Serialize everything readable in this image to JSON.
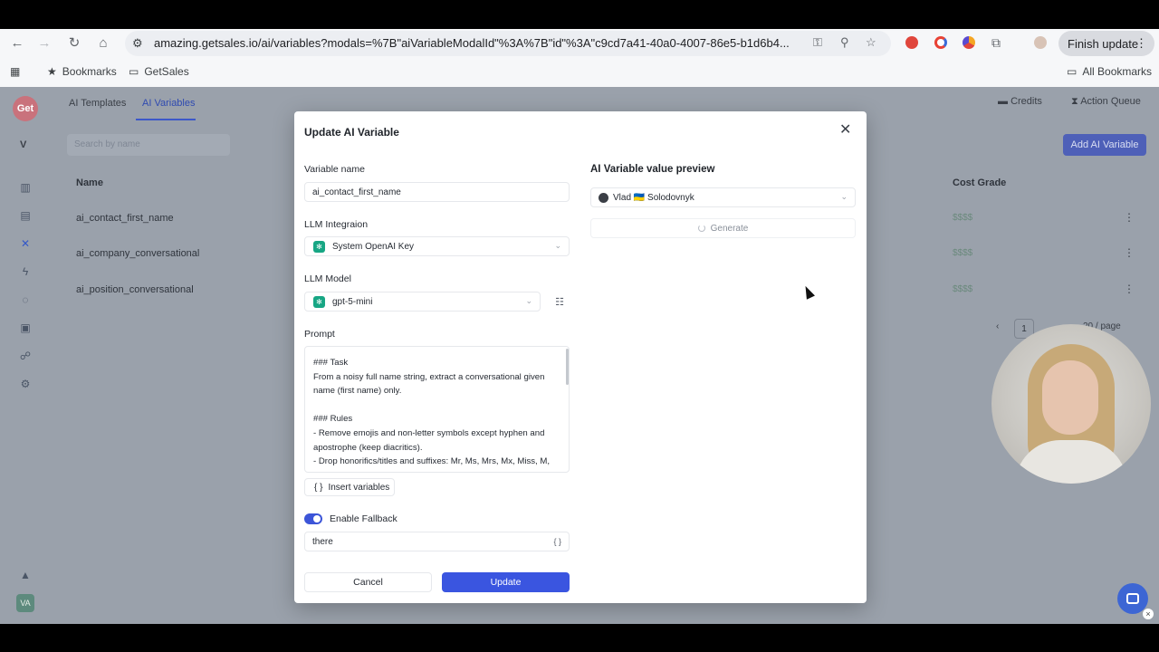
{
  "browser": {
    "url": "amazing.getsales.io/ai/variables?modals=%7B\"aiVariableModalId\"%3A%7B\"id\"%3A\"c9cd7a41-40a0-4007-86e5-b1d6b4...",
    "finish_update": "Finish update",
    "bookmarks": [
      "Bookmarks",
      "GetSales"
    ],
    "all_bookmarks": "All Bookmarks"
  },
  "app": {
    "logo": "Get",
    "workspace_initial": "V",
    "user_initials": "VA",
    "tabs": [
      "AI Templates",
      "AI Variables"
    ],
    "active_tab": "AI Variables",
    "credits": "Credits",
    "action_queue": "Action Queue",
    "search_placeholder": "Search by name",
    "add_button": "Add AI Variable",
    "columns": {
      "name": "Name",
      "cost_grade": "Cost Grade"
    },
    "rows": [
      {
        "name": "ai_contact_first_name",
        "cost": "$$$$"
      },
      {
        "name": "ai_company_conversational",
        "cost": "$$$$"
      },
      {
        "name": "ai_position_conversational",
        "cost": "$$$$"
      }
    ],
    "page_number": "1",
    "per_page": "20 / page"
  },
  "modal": {
    "title": "Update AI Variable",
    "variable_name_label": "Variable name",
    "variable_name_value": "ai_contact_first_name",
    "llm_integration_label": "LLM Integraion",
    "llm_integration_value": "System OpenAI Key",
    "llm_model_label": "LLM Model",
    "llm_model_value": "gpt-5-mini",
    "prompt_label": "Prompt",
    "prompt_text": "### Task\nFrom a noisy full name string, extract a conversational given name (first name) only.\n\n### Rules\n- Remove emojis and non-letter symbols except hyphen and apostrophe (keep diacritics).\n- Drop honorifics/titles and suffixes: Mr, Ms, Mrs, Mx, Miss, M, Mme, Dr, Prof, Sir, Dame, Lord, Lady, Eng, Lic, Ing, Esq",
    "insert_variables": "Insert variables",
    "enable_fallback_label": "Enable Fallback",
    "fallback_value": "there",
    "cancel": "Cancel",
    "update": "Update",
    "preview_title": "AI Variable value preview",
    "preview_contact": "Vlad 🇺🇦 Solodovnyk",
    "generate": "Generate"
  }
}
